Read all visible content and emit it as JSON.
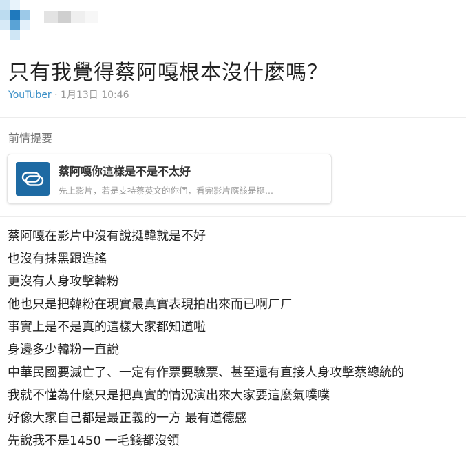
{
  "post": {
    "title": "只有我覺得蔡阿嘎根本沒什麼嗎？",
    "author": "YouTuber",
    "separator": "·",
    "timestamp": "1月13日 10:46"
  },
  "reference": {
    "section_label": "前情提要",
    "icon": "link-icon",
    "title": "蔡阿嘎你這樣是不是不太好",
    "description": "先上影片，若是支持蔡英文的你們，看完影片應該是挺..."
  },
  "body": {
    "lines": [
      "蔡阿嘎在影片中沒有說挺韓就是不好",
      "也沒有抹黑跟造謠",
      "更沒有人身攻擊韓粉",
      "他也只是把韓粉在現實最真實表現拍出來而已啊ㄏㄏ",
      "事實上是不是真的這樣大家都知道啦",
      "身邊多少韓粉一直說",
      "中華民國要滅亡了、一定有作票要驗票、甚至還有直接人身攻擊蔡總統的",
      "我就不懂為什麼只是把真實的情況演出來大家要這麼氣噗噗",
      "好像大家自己都是最正義的一方 最有道德感",
      "先說我不是1450 一毛錢都沒領"
    ]
  },
  "colors": {
    "author": "#3a8fc7",
    "ref_icon_bg": "#1e6aa3",
    "avatar_pixels": [
      "#cfe6f5",
      "#e8f3fb",
      "#ffffff",
      "#ffffff",
      "#bcdcf0",
      "#1f79bd",
      "#9cc9e8",
      "#ffffff",
      "#d7eaf7",
      "#5aa3d6",
      "#e3f0fa",
      "#ffffff",
      "#ffffff",
      "#cfe6f5",
      "#ffffff",
      "#ffffff"
    ],
    "name_blur": [
      "#e3e3e3",
      "#cfcfcf",
      "#efefef",
      "#f7f7f7"
    ]
  }
}
